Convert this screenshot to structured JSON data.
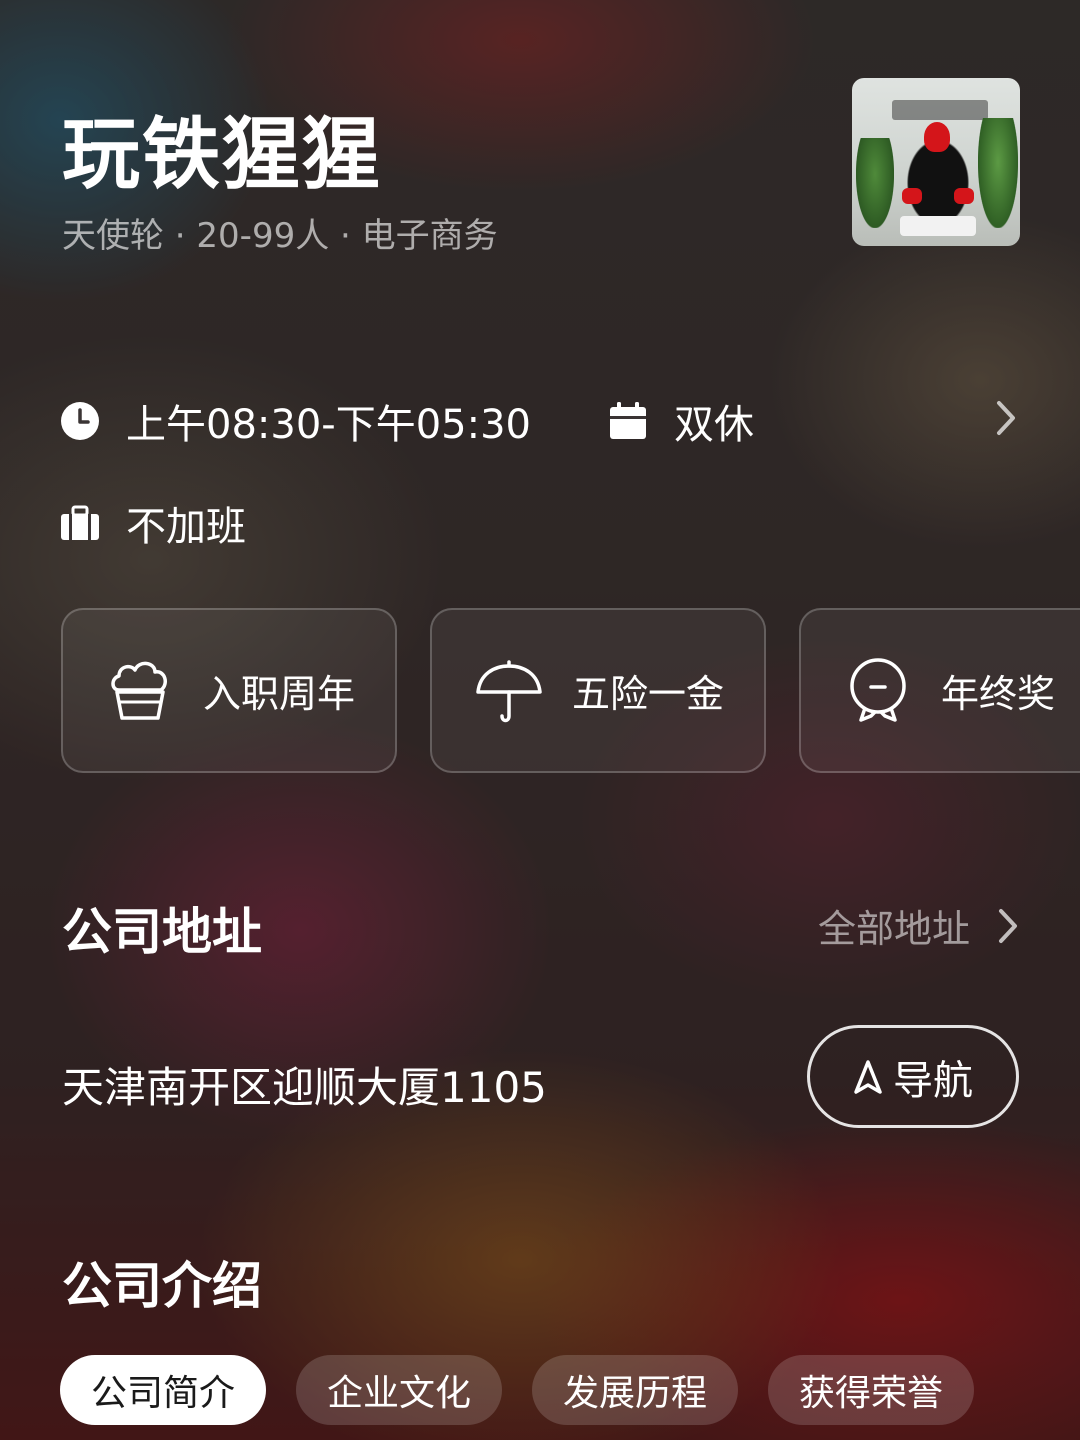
{
  "company": {
    "name": "玩铁猩猩",
    "meta": "天使轮 · 20-99人 · 电子商务"
  },
  "logo": {
    "icon": "company-logo-gorilla",
    "brand_color": "#d4151a"
  },
  "work_info": {
    "hours": "上午08:30-下午05:30",
    "rest": "双休",
    "overtime": "不加班"
  },
  "benefits": [
    {
      "label": "入职周年",
      "icon": "cupcake-icon"
    },
    {
      "label": "五险一金",
      "icon": "umbrella-icon"
    },
    {
      "label": "年终奖",
      "icon": "medal-icon"
    }
  ],
  "address_section": {
    "title": "公司地址",
    "all_label": "全部地址",
    "address": "天津南开区迎顺大厦1105",
    "nav_label": "导航"
  },
  "intro_section": {
    "title": "公司介绍",
    "tabs": [
      {
        "label": "公司简介",
        "active": true
      },
      {
        "label": "企业文化",
        "active": false
      },
      {
        "label": "发展历程",
        "active": false
      },
      {
        "label": "获得荣誉",
        "active": false
      }
    ]
  }
}
